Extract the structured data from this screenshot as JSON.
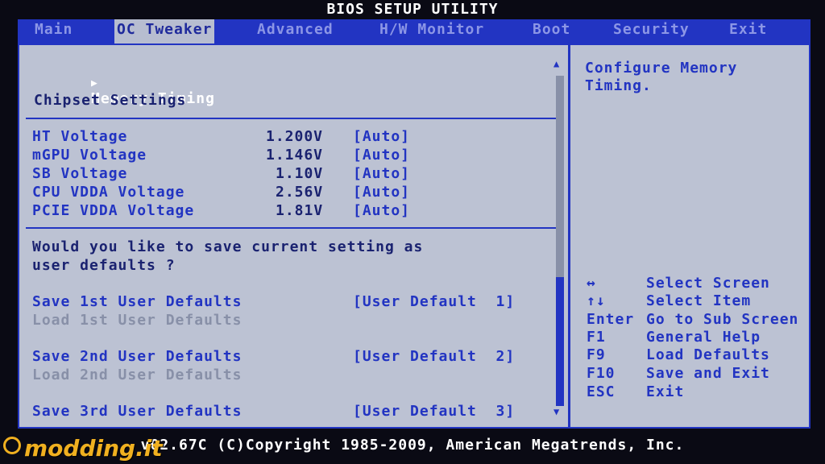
{
  "title": "BIOS SETUP UTILITY",
  "menu": [
    "Main",
    "OC Tweaker",
    "Advanced",
    "H/W Monitor",
    "Boot",
    "Security",
    "Exit"
  ],
  "left": {
    "submenu": "Memory Timing",
    "submenu_arrow": "▶",
    "section_title": "Chipset Settings",
    "voltages": [
      {
        "label": "HT Voltage",
        "value": "1.200V",
        "setting": "[Auto]"
      },
      {
        "label": "mGPU Voltage",
        "value": "1.146V",
        "setting": "[Auto]"
      },
      {
        "label": "SB Voltage",
        "value": "1.10V",
        "setting": "[Auto]"
      },
      {
        "label": "CPU VDDA Voltage",
        "value": "2.56V",
        "setting": "[Auto]"
      },
      {
        "label": "PCIE VDDA Voltage",
        "value": "1.81V",
        "setting": "[Auto]"
      }
    ],
    "question_line1": "Would you like to save current setting as",
    "question_line2": "user defaults ?",
    "defaults": [
      {
        "save": "Save 1st User Defaults",
        "save_value": "[User Default  1]",
        "load": "Load 1st User Defaults"
      },
      {
        "save": "Save 2nd User Defaults",
        "save_value": "[User Default  2]",
        "load": "Load 2nd User Defaults"
      },
      {
        "save": "Save 3rd User Defaults",
        "save_value": "[User Default  3]"
      }
    ]
  },
  "help": {
    "line1": "Configure Memory",
    "line2": "Timing.",
    "keys": [
      {
        "key": "↔",
        "desc": "Select Screen"
      },
      {
        "key": "↑↓",
        "desc": "Select Item"
      },
      {
        "key": "Enter",
        "desc": "Go to Sub Screen"
      },
      {
        "key": "F1",
        "desc": "General Help"
      },
      {
        "key": "F9",
        "desc": "Load Defaults"
      },
      {
        "key": "F10",
        "desc": "Save and Exit"
      },
      {
        "key": "ESC",
        "desc": "Exit"
      }
    ]
  },
  "footer": "v02.67C (C)Copyright 1985-2009, American Megatrends, Inc.",
  "watermark": "modding.it"
}
